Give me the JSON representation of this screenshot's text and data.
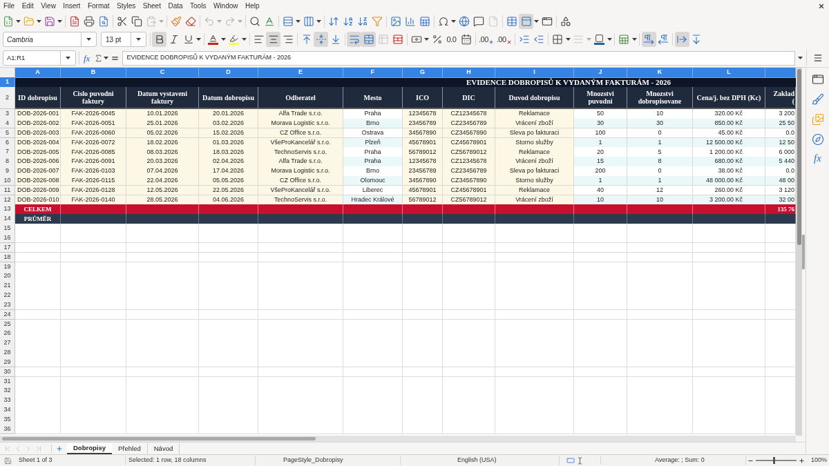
{
  "menu_bar": {
    "items": [
      "File",
      "Edit",
      "View",
      "Insert",
      "Format",
      "Styles",
      "Sheet",
      "Data",
      "Tools",
      "Window",
      "Help"
    ]
  },
  "standard_toolbar": {
    "buttons": [
      {
        "on": false,
        "disabled": false
      },
      {
        "on": false,
        "disabled": false
      },
      {
        "on": false,
        "disabled": false
      },
      {
        "on": false,
        "disabled": false
      },
      {
        "on": false,
        "disabled": false
      },
      {
        "on": false,
        "disabled": false
      },
      {
        "on": false,
        "disabled": false
      },
      {
        "on": false,
        "disabled": false
      },
      {
        "on": false,
        "disabled": true
      },
      {
        "on": false,
        "disabled": false
      },
      {
        "on": false,
        "disabled": false
      },
      {
        "on": false,
        "disabled": true
      },
      {
        "on": false,
        "disabled": true
      },
      {
        "on": false,
        "disabled": false
      },
      {
        "on": false,
        "disabled": false
      },
      {
        "on": false,
        "disabled": false
      },
      {
        "on": false,
        "disabled": false
      },
      {
        "on": false,
        "disabled": false
      },
      {
        "on": false,
        "disabled": false
      },
      {
        "on": false,
        "disabled": false
      },
      {
        "on": false,
        "disabled": false
      },
      {
        "on": false,
        "disabled": false
      },
      {
        "on": false,
        "disabled": false
      },
      {
        "on": false,
        "disabled": false
      },
      {
        "on": false,
        "disabled": false
      },
      {
        "on": false,
        "disabled": false
      },
      {
        "on": false,
        "disabled": false
      },
      {
        "on": false,
        "disabled": true
      },
      {
        "on": false,
        "disabled": false
      },
      {
        "on": true,
        "disabled": false
      },
      {
        "on": false,
        "disabled": false
      },
      {
        "on": false,
        "disabled": false
      }
    ]
  },
  "formatting_toolbar": {
    "font_name": "Cambria",
    "font_size": "13 pt",
    "buttons": [
      {
        "on": true,
        "disabled": false
      },
      {
        "on": false,
        "disabled": false
      },
      {
        "on": false,
        "disabled": false
      },
      {
        "on": false,
        "disabled": false
      },
      {
        "on": false,
        "disabled": false
      },
      {
        "on": false,
        "disabled": false
      },
      {
        "on": true,
        "disabled": false
      },
      {
        "on": false,
        "disabled": false
      },
      {
        "on": false,
        "disabled": false
      },
      {
        "on": true,
        "disabled": false
      },
      {
        "on": false,
        "disabled": false
      },
      {
        "on": true,
        "disabled": false
      },
      {
        "on": true,
        "disabled": false
      },
      {
        "on": false,
        "disabled": true
      },
      {
        "on": false,
        "disabled": false
      },
      {
        "on": false,
        "disabled": false
      },
      {
        "on": false,
        "disabled": false
      },
      {
        "glyph": "0.0",
        "on": false,
        "disabled": false
      },
      {
        "on": false,
        "disabled": false
      },
      {
        "glyph": ".00",
        "on": false,
        "disabled": false
      },
      {
        "glyph": ".00",
        "on": false,
        "disabled": false
      },
      {
        "on": false,
        "disabled": false
      },
      {
        "on": false,
        "disabled": false
      },
      {
        "on": false,
        "disabled": false
      },
      {
        "on": false,
        "disabled": true
      },
      {
        "on": false,
        "disabled": false
      },
      {
        "on": false,
        "disabled": false
      },
      {
        "on": true,
        "disabled": false
      },
      {
        "on": false,
        "disabled": false
      },
      {
        "on": true,
        "disabled": false
      },
      {
        "on": false,
        "disabled": false
      }
    ]
  },
  "formula_bar": {
    "name_box": "A1:R1",
    "function_glyph": "fx",
    "content": "EVIDENCE DOBROPISŮ K VYDANÝM FAKTURÁM - 2026"
  },
  "sheet": {
    "columns": [
      {
        "label": "A",
        "selected": true,
        "kind": "shaded"
      },
      {
        "label": "B",
        "selected": true,
        "kind": "shaded"
      },
      {
        "label": "C",
        "selected": true,
        "kind": "shaded"
      },
      {
        "label": "D",
        "selected": true,
        "kind": "shaded"
      },
      {
        "label": "E",
        "selected": true,
        "kind": "shaded"
      },
      {
        "label": "F",
        "selected": true,
        "kind": "striped"
      },
      {
        "label": "G",
        "selected": true,
        "kind": "shaded"
      },
      {
        "label": "H",
        "selected": true,
        "kind": "shaded"
      },
      {
        "label": "I",
        "selected": true,
        "kind": "shaded"
      },
      {
        "label": "J",
        "selected": true,
        "kind": "striped"
      },
      {
        "label": "K",
        "selected": true,
        "kind": "striped"
      },
      {
        "label": "L",
        "selected": true,
        "kind": "striped"
      },
      {
        "selected": true,
        "kind": "striped"
      }
    ],
    "rows": [
      {
        "number": "1",
        "selected": true,
        "kind": "title",
        "text": "EVIDENCE DOBROPISŮ K VYDANÝM FAKTURÁM - 2026"
      },
      {
        "number": "2",
        "selected": false,
        "kind": "header",
        "cells": [
          "ID dobropisu",
          "Cislo puvodni faktury",
          "Datum vystaveni faktury",
          "Datum dobropisu",
          "Odberatel",
          "Mesto",
          "ICO",
          "DIC",
          "Duvod dobropisu",
          "Mnozstvi puvodni",
          "Mnozstvi dobropisovane",
          "Cena/j. bez DPH (Kc)",
          "Zaklad ("
        ]
      },
      {
        "number": "3",
        "selected": false,
        "kind": "data",
        "cells": [
          "DOB-2026-001",
          "FAK-2026-0045",
          "10.01.2026",
          "20.01.2026",
          "Alfa Trade s.r.o.",
          "Praha",
          "12345678",
          "CZ12345678",
          "Reklamace",
          "50",
          "10",
          "320.00 Kč",
          "3 200"
        ]
      },
      {
        "number": "4",
        "selected": false,
        "kind": "data",
        "cells": [
          "DOB-2026-002",
          "FAK-2026-0051",
          "25.01.2026",
          "03.02.2026",
          "Morava Logistic s.r.o.",
          "Brno",
          "23456789",
          "CZ23456789",
          "Vrácení zboží",
          "30",
          "30",
          "850.00 Kč",
          "25 50"
        ]
      },
      {
        "number": "5",
        "selected": false,
        "kind": "data",
        "cells": [
          "DOB-2026-003",
          "FAK-2026-0060",
          "05.02.2026",
          "15.02.2026",
          "CZ Office s.r.o.",
          "Ostrava",
          "34567890",
          "CZ34567890",
          "Sleva po fakturaci",
          "100",
          "0",
          "45.00 Kč",
          "0.0"
        ]
      },
      {
        "number": "6",
        "selected": false,
        "kind": "data",
        "cells": [
          "DOB-2026-004",
          "FAK-2026-0072",
          "18.02.2026",
          "01.03.2026",
          "VšeProKancelář s.r.o.",
          "Plzeň",
          "45678901",
          "CZ45678901",
          "Storno služby",
          "1",
          "1",
          "12 500.00 Kč",
          "12 50"
        ]
      },
      {
        "number": "7",
        "selected": false,
        "kind": "data",
        "cells": [
          "DOB-2026-005",
          "FAK-2026-0085",
          "08.03.2026",
          "18.03.2026",
          "TechnoServis s.r.o.",
          "Praha",
          "56789012",
          "CZ56789012",
          "Reklamace",
          "20",
          "5",
          "1 200.00 Kč",
          "6 000"
        ]
      },
      {
        "number": "8",
        "selected": false,
        "kind": "data",
        "cells": [
          "DOB-2026-006",
          "FAK-2026-0091",
          "20.03.2026",
          "02.04.2026",
          "Alfa Trade s.r.o.",
          "Praha",
          "12345678",
          "CZ12345678",
          "Vrácení zboží",
          "15",
          "8",
          "680.00 Kč",
          "5 440"
        ]
      },
      {
        "number": "9",
        "selected": false,
        "kind": "data",
        "cells": [
          "DOB-2026-007",
          "FAK-2026-0103",
          "07.04.2026",
          "17.04.2026",
          "Morava Logistic s.r.o.",
          "Brno",
          "23456789",
          "CZ23456789",
          "Sleva po fakturaci",
          "200",
          "0",
          "38.00 Kč",
          "0.0"
        ]
      },
      {
        "number": "10",
        "selected": false,
        "kind": "data",
        "cells": [
          "DOB-2026-008",
          "FAK-2026-0115",
          "22.04.2026",
          "05.05.2026",
          "CZ Office s.r.o.",
          "Olomouc",
          "34567890",
          "CZ34567890",
          "Storno služby",
          "1",
          "1",
          "48 000.00 Kč",
          "48 00"
        ]
      },
      {
        "number": "11",
        "selected": false,
        "kind": "data",
        "cells": [
          "DOB-2026-009",
          "FAK-2026-0128",
          "12.05.2026",
          "22.05.2026",
          "VšeProKancelář s.r.o.",
          "Liberec",
          "45678901",
          "CZ45678901",
          "Reklamace",
          "40",
          "12",
          "260.00 Kč",
          "3 120"
        ]
      },
      {
        "number": "12",
        "selected": false,
        "kind": "data",
        "cells": [
          "DOB-2026-010",
          "FAK-2026-0140",
          "28.05.2026",
          "04.06.2026",
          "TechnoServis s.r.o.",
          "Hradec Králové",
          "56789012",
          "CZ56789012",
          "Vrácení zboží",
          "10",
          "10",
          "3 200.00 Kč",
          "32 00"
        ]
      },
      {
        "number": "13",
        "selected": false,
        "kind": "total",
        "label": "CELKEM",
        "value": "135 76"
      },
      {
        "number": "14",
        "selected": false,
        "kind": "average",
        "label": "PRŮMĚR"
      },
      {
        "number": "15",
        "selected": false,
        "kind": "empty"
      },
      {
        "number": "16",
        "selected": false,
        "kind": "empty"
      },
      {
        "number": "17",
        "selected": false,
        "kind": "empty"
      },
      {
        "number": "18",
        "selected": false,
        "kind": "empty"
      },
      {
        "number": "19",
        "selected": false,
        "kind": "empty"
      },
      {
        "number": "20",
        "selected": false,
        "kind": "empty"
      },
      {
        "number": "21",
        "selected": false,
        "kind": "empty"
      },
      {
        "number": "22",
        "selected": false,
        "kind": "empty"
      },
      {
        "number": "23",
        "selected": false,
        "kind": "empty"
      },
      {
        "number": "24",
        "selected": false,
        "kind": "empty"
      },
      {
        "number": "25",
        "selected": false,
        "kind": "empty"
      },
      {
        "number": "26",
        "selected": false,
        "kind": "empty"
      },
      {
        "number": "27",
        "selected": false,
        "kind": "empty"
      },
      {
        "number": "28",
        "selected": false,
        "kind": "empty"
      },
      {
        "number": "29",
        "selected": false,
        "kind": "empty"
      },
      {
        "number": "30",
        "selected": false,
        "kind": "empty"
      },
      {
        "number": "31",
        "selected": false,
        "kind": "empty"
      },
      {
        "number": "32",
        "selected": false,
        "kind": "empty"
      },
      {
        "number": "33",
        "selected": false,
        "kind": "empty"
      },
      {
        "number": "34",
        "selected": false,
        "kind": "empty"
      },
      {
        "number": "35",
        "selected": false,
        "kind": "empty"
      },
      {
        "number": "36",
        "selected": false,
        "kind": "empty"
      }
    ]
  },
  "sheet_tabs": [
    {
      "label": "Dobropisy",
      "selected": true
    },
    {
      "label": "Přehled",
      "selected": false
    },
    {
      "label": "Návod",
      "selected": false
    }
  ],
  "sidebar": {
    "function_glyph": "fx"
  },
  "status_bar": {
    "sheet": "Sheet 1 of 3",
    "selection": "Selected: 1 row, 18 columns",
    "page_style": "PageStyle_Dobropisy",
    "language": "English (USA)",
    "summary": "Average: ; Sum: 0",
    "zoom": {
      "level": 0.44,
      "reading": "100%"
    }
  }
}
